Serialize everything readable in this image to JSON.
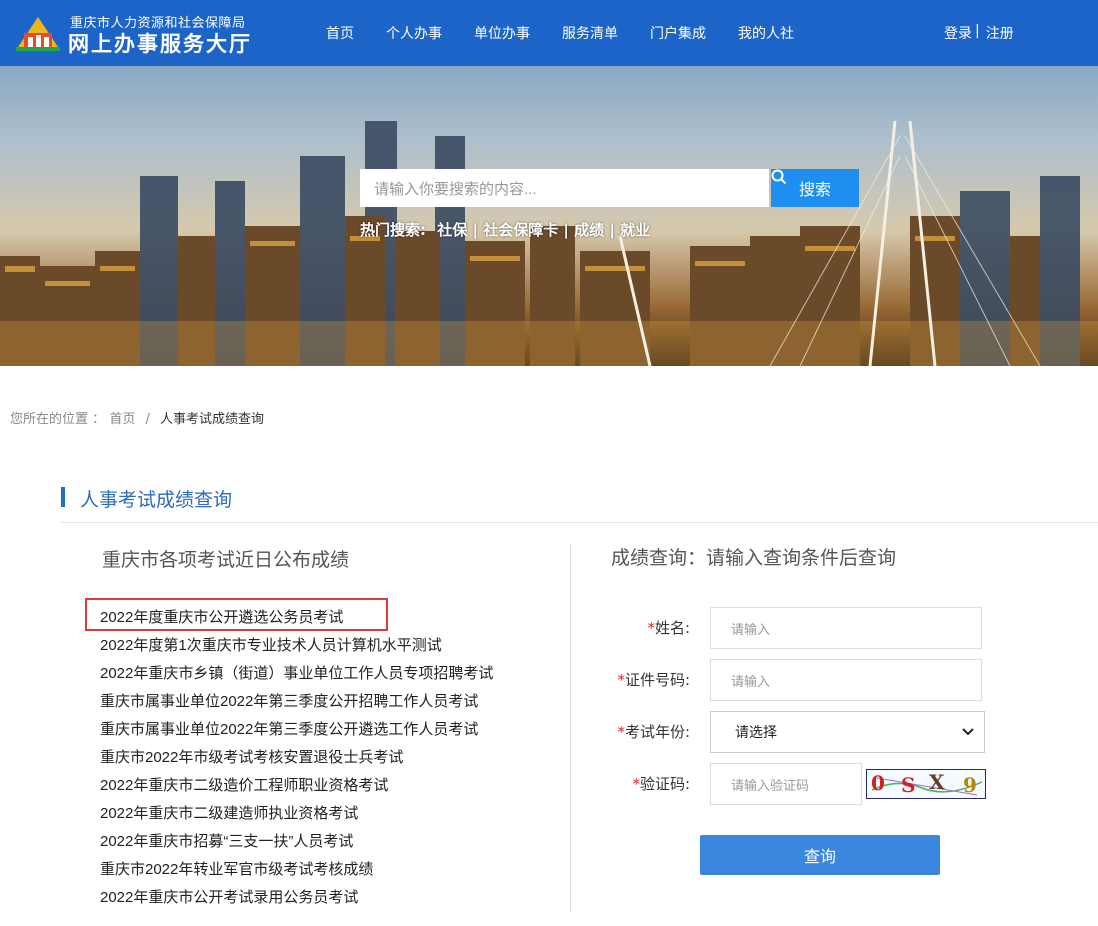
{
  "header": {
    "org_name": "重庆市人力资源和社会保障局",
    "site_name": "网上办事服务大厅",
    "nav": [
      "首页",
      "个人办事",
      "单位办事",
      "服务清单",
      "门户集成",
      "我的人社"
    ],
    "login": "登录",
    "separator": "|",
    "register": "注册"
  },
  "banner": {
    "search_placeholder": "请输入你要搜索的内容...",
    "search_button": "搜索",
    "hot_label": "热门搜索:",
    "hot_items": [
      "社保",
      "社会保障卡",
      "成绩",
      "就业"
    ]
  },
  "breadcrumb": {
    "prefix": "您所在的位置",
    "colon": "：",
    "home": "首页",
    "slash": "/",
    "current": "人事考试成绩查询"
  },
  "section_title": "人事考试成绩查询",
  "left": {
    "heading": "重庆市各项考试近日公布成绩",
    "exams": [
      "2022年度重庆市公开遴选公务员考试",
      "2022年度第1次重庆市专业技术人员计算机水平测试",
      "2022年重庆市乡镇（街道）事业单位工作人员专项招聘考试",
      "重庆市属事业单位2022年第三季度公开招聘工作人员考试",
      "重庆市属事业单位2022年第三季度公开遴选工作人员考试",
      "重庆市2022年市级考试考核安置退役士兵考试",
      "2022年重庆市二级造价工程师职业资格考试",
      "2022年重庆市二级建造师执业资格考试",
      "2022年重庆市招募“三支一扶”人员考试",
      "重庆市2022年转业军官市级考试考核成绩",
      "2022年重庆市公开考试录用公务员考试"
    ]
  },
  "right": {
    "heading": "成绩查询：请输入查询条件后查询",
    "required_mark": "*",
    "name_label": "姓名:",
    "name_placeholder": "请输入",
    "id_label": "证件号码:",
    "id_placeholder": "请输入",
    "year_label": "考试年份:",
    "year_selected": "请选择",
    "captcha_label": "验证码:",
    "captcha_placeholder": "请输入验证码",
    "captcha_text": [
      "0",
      "S",
      "X",
      "9"
    ],
    "query_button": "查询"
  },
  "colors": {
    "header_bg": "#1c64c8",
    "search_button": "#1e8ef0",
    "section_accent": "#1e6fd0",
    "query_button": "#3b86df",
    "highlight_border": "#e03a3a",
    "required": "#e02020"
  }
}
